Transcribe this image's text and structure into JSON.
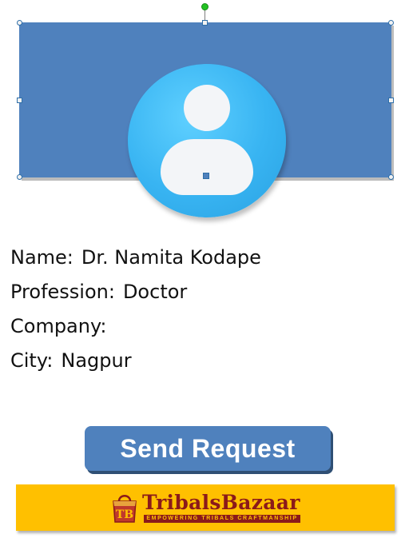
{
  "profile": {
    "name_label": "Name:",
    "name_value": "Dr. Namita Kodape",
    "profession_label": "Profession:",
    "profession_value": "Doctor",
    "company_label": "Company:",
    "company_value": "",
    "city_label": "City:",
    "city_value": "Nagpur"
  },
  "actions": {
    "send_request_label": "Send Request"
  },
  "footer": {
    "brand_name": "TribalsBazaar",
    "tagline": "EMPOWERING TRIBALS CRAFTMANSHIP"
  },
  "colors": {
    "banner": "#4f81bd",
    "avatar": "#38b4f2",
    "footer": "#ffc000",
    "brand_text": "#8b1a1a"
  },
  "icons": {
    "avatar": "user-avatar-icon",
    "logo": "shopping-bag-icon"
  }
}
